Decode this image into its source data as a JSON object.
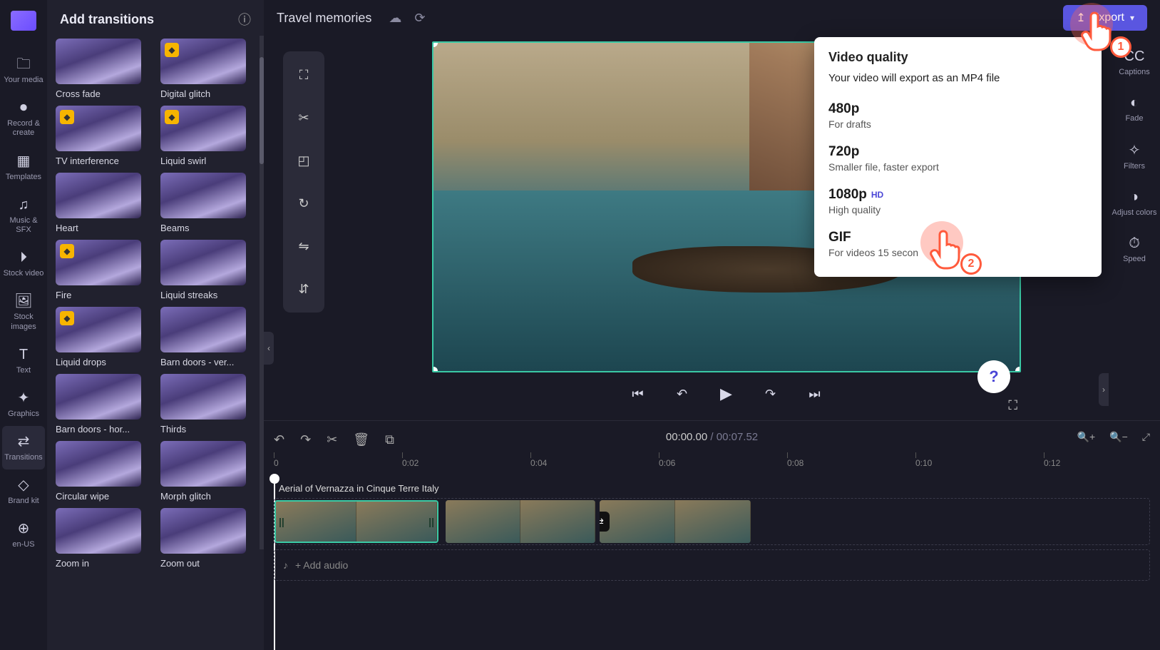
{
  "project_title": "Travel memories",
  "export_button": "Export",
  "left_rail": [
    {
      "label": "Your media"
    },
    {
      "label": "Record & create"
    },
    {
      "label": "Templates"
    },
    {
      "label": "Music & SFX"
    },
    {
      "label": "Stock video"
    },
    {
      "label": "Stock images"
    },
    {
      "label": "Text"
    },
    {
      "label": "Graphics"
    },
    {
      "label": "Transitions"
    },
    {
      "label": "Brand kit"
    },
    {
      "label": "en-US"
    }
  ],
  "right_rail": [
    {
      "label": "Captions"
    },
    {
      "label": "Fade"
    },
    {
      "label": "Filters"
    },
    {
      "label": "Adjust colors"
    },
    {
      "label": "Speed"
    }
  ],
  "panel_title": "Add transitions",
  "transitions": [
    {
      "label": "Cross fade",
      "premium": false
    },
    {
      "label": "Digital glitch",
      "premium": true
    },
    {
      "label": "TV interference",
      "premium": true
    },
    {
      "label": "Liquid swirl",
      "premium": true
    },
    {
      "label": "Heart",
      "premium": false
    },
    {
      "label": "Beams",
      "premium": false
    },
    {
      "label": "Fire",
      "premium": true
    },
    {
      "label": "Liquid streaks",
      "premium": false
    },
    {
      "label": "Liquid drops",
      "premium": true
    },
    {
      "label": "Barn doors - ver...",
      "premium": false
    },
    {
      "label": "Barn doors - hor...",
      "premium": false
    },
    {
      "label": "Thirds",
      "premium": false
    },
    {
      "label": "Circular wipe",
      "premium": false
    },
    {
      "label": "Morph glitch",
      "premium": false
    },
    {
      "label": "Zoom in",
      "premium": false
    },
    {
      "label": "Zoom out",
      "premium": false
    }
  ],
  "export_popup": {
    "title": "Video quality",
    "subtitle": "Your video will export as an MP4 file",
    "options": [
      {
        "name": "480p",
        "desc": "For drafts",
        "hd": false
      },
      {
        "name": "720p",
        "desc": "Smaller file, faster export",
        "hd": false
      },
      {
        "name": "1080p",
        "desc": "High quality",
        "hd": true
      },
      {
        "name": "GIF",
        "desc": "For videos 15 secon",
        "hd": false
      }
    ]
  },
  "timeline": {
    "current": "00:00.00",
    "total": "00:07.52",
    "clip_title": "Aerial of Vernazza in Cinque Terre Italy",
    "add_audio": "+ Add audio",
    "ticks": [
      "0",
      "0:02",
      "0:04",
      "0:06",
      "0:08",
      "0:10",
      "0:12"
    ]
  },
  "touch_labels": {
    "one": "1",
    "two": "2"
  },
  "icons": {
    "premium": "◆",
    "help": "?",
    "hd": "HD"
  }
}
